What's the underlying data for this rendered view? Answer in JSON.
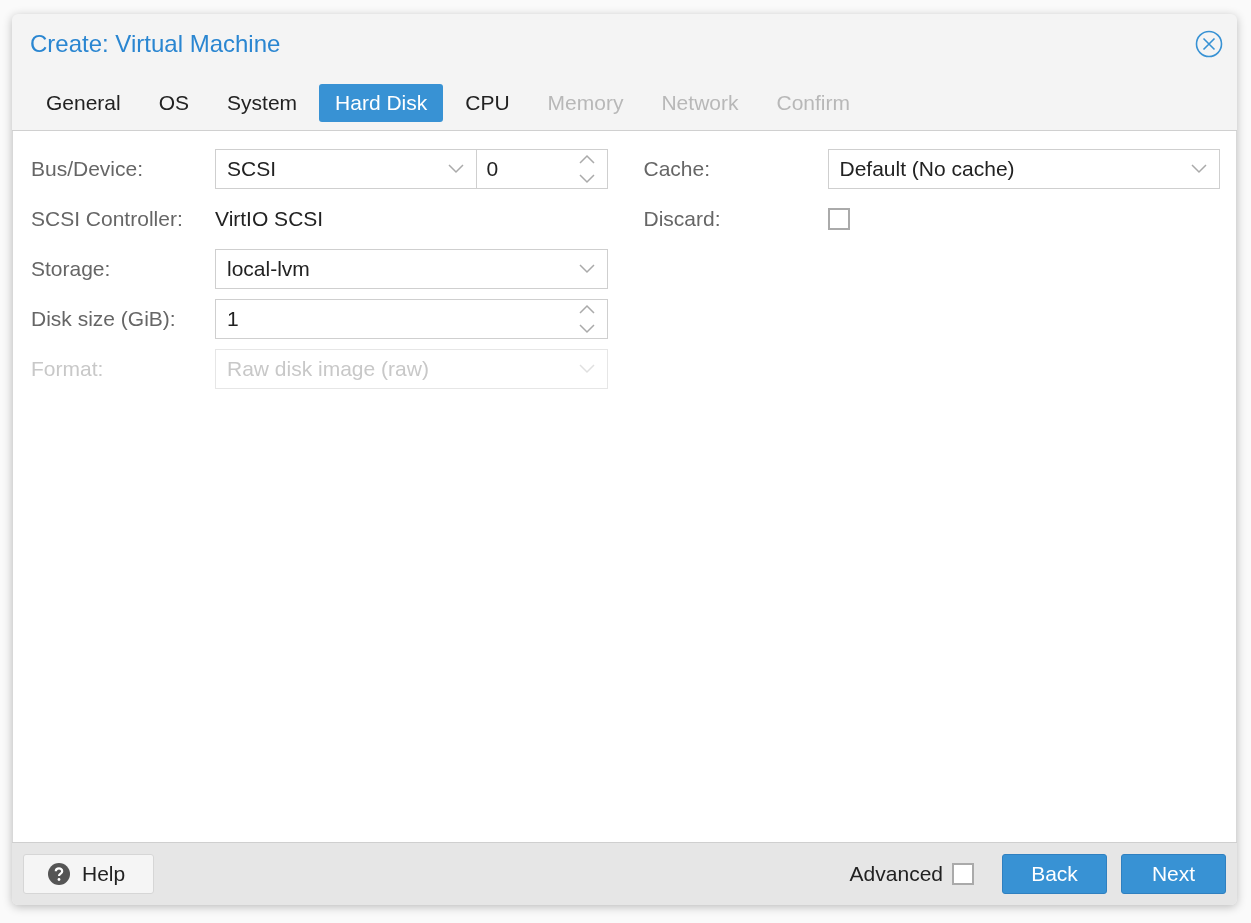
{
  "window": {
    "title": "Create: Virtual Machine"
  },
  "tabs": [
    {
      "label": "General",
      "selected": false,
      "disabled": false
    },
    {
      "label": "OS",
      "selected": false,
      "disabled": false
    },
    {
      "label": "System",
      "selected": false,
      "disabled": false
    },
    {
      "label": "Hard Disk",
      "selected": true,
      "disabled": false
    },
    {
      "label": "CPU",
      "selected": false,
      "disabled": false
    },
    {
      "label": "Memory",
      "selected": false,
      "disabled": true
    },
    {
      "label": "Network",
      "selected": false,
      "disabled": true
    },
    {
      "label": "Confirm",
      "selected": false,
      "disabled": true
    }
  ],
  "left_fields": [
    {
      "kind": "combo-spinner",
      "label": "Bus/Device:",
      "value": "SCSI",
      "value_2": "0",
      "disabled": false
    },
    {
      "kind": "display",
      "label": "SCSI Controller:",
      "value": "VirtIO SCSI",
      "disabled": false
    },
    {
      "kind": "combo",
      "label": "Storage:",
      "value": "local-lvm",
      "disabled": false
    },
    {
      "kind": "spinner",
      "label": "Disk size (GiB):",
      "value": "1",
      "disabled": false
    },
    {
      "kind": "combo",
      "label": "Format:",
      "value": "Raw disk image (raw)",
      "disabled": true
    }
  ],
  "right_fields": [
    {
      "kind": "combo",
      "label": "Cache:",
      "value": "Default (No cache)",
      "disabled": false
    },
    {
      "kind": "checkbox",
      "label": "Discard:",
      "checked": false,
      "disabled": false
    }
  ],
  "footer": {
    "help": "Help",
    "advanced": {
      "label": "Advanced",
      "checked": false
    },
    "buttons": [
      "Back",
      "Next"
    ]
  }
}
